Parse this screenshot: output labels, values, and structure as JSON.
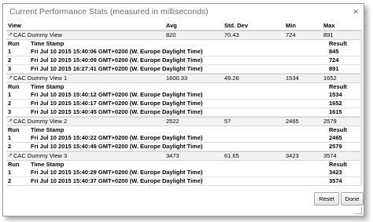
{
  "dialog": {
    "title": "Current Performance Stats (measured in milliseconds)",
    "close_glyph": "×"
  },
  "table_header": {
    "view": "View",
    "avg": "Avg",
    "std_dev": "Std. Dev",
    "min": "Min",
    "max": "Max"
  },
  "sub_header": {
    "run": "Run",
    "time_stamp": "Time Stamp",
    "result": "Result"
  },
  "views": [
    {
      "name": "CAC Dummy View",
      "avg": "820",
      "std_dev": "70.43",
      "min": "724",
      "max": "891",
      "runs": [
        {
          "run": "1",
          "time": "Fri Jul 10 2015 15:40:06 GMT+0200 (W. Europe Daylight Time)",
          "result": "845"
        },
        {
          "run": "2",
          "time": "Fri Jul 10 2015 15:40:09 GMT+0200 (W. Europe Daylight Time)",
          "result": "724"
        },
        {
          "run": "3",
          "time": "Fri Jul 10 2015 16:27:41 GMT+0200 (W. Europe Daylight Time)",
          "result": "891"
        }
      ]
    },
    {
      "name": "CAC Dummy View 1",
      "avg": "1600.33",
      "std_dev": "49.28",
      "min": "1534",
      "max": "1652",
      "runs": [
        {
          "run": "1",
          "time": "Fri Jul 10 2015 15:40:12 GMT+0200 (W. Europe Daylight Time)",
          "result": "1534"
        },
        {
          "run": "2",
          "time": "Fri Jul 10 2015 15:40:17 GMT+0200 (W. Europe Daylight Time)",
          "result": "1652"
        },
        {
          "run": "3",
          "time": "Fri Jul 10 2015 15:40:45 GMT+0200 (W. Europe Daylight Time)",
          "result": "1615"
        }
      ]
    },
    {
      "name": "CAC Dummy View 2",
      "avg": "2522",
      "std_dev": "57",
      "min": "2465",
      "max": "2579",
      "runs": [
        {
          "run": "1",
          "time": "Fri Jul 10 2015 15:40:22 GMT+0200 (W. Europe Daylight Time)",
          "result": "2465"
        },
        {
          "run": "2",
          "time": "Fri Jul 10 2015 15:40:49 GMT+0200 (W. Europe Daylight Time)",
          "result": "2579"
        }
      ]
    },
    {
      "name": "CAC Dummy View 3",
      "avg": "3473",
      "std_dev": "61.65",
      "min": "3423",
      "max": "3574",
      "runs": [
        {
          "run": "1",
          "time": "Fri Jul 10 2015 15:40:29 GMT+0200 (W. Europe Daylight Time)",
          "result": "3423"
        },
        {
          "run": "2",
          "time": "Fri Jul 10 2015 15:40:37 GMT+0200 (W. Europe Daylight Time)",
          "result": "3574"
        },
        {
          "run": "3",
          "time": "Fri Jul 10 2015 15:40:54 GMT+0200 (W. Europe Daylight Time)",
          "result": "3472"
        }
      ]
    }
  ],
  "buttons": {
    "reset": "Reset",
    "done": "Done"
  }
}
